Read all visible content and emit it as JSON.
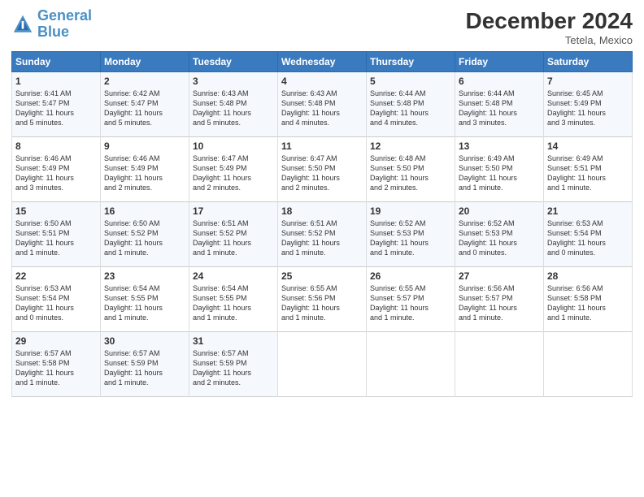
{
  "header": {
    "logo_line1": "General",
    "logo_line2": "Blue",
    "month": "December 2024",
    "location": "Tetela, Mexico"
  },
  "days_of_week": [
    "Sunday",
    "Monday",
    "Tuesday",
    "Wednesday",
    "Thursday",
    "Friday",
    "Saturday"
  ],
  "weeks": [
    [
      {
        "day": "1",
        "text": "Sunrise: 6:41 AM\nSunset: 5:47 PM\nDaylight: 11 hours\nand 5 minutes."
      },
      {
        "day": "2",
        "text": "Sunrise: 6:42 AM\nSunset: 5:47 PM\nDaylight: 11 hours\nand 5 minutes."
      },
      {
        "day": "3",
        "text": "Sunrise: 6:43 AM\nSunset: 5:48 PM\nDaylight: 11 hours\nand 5 minutes."
      },
      {
        "day": "4",
        "text": "Sunrise: 6:43 AM\nSunset: 5:48 PM\nDaylight: 11 hours\nand 4 minutes."
      },
      {
        "day": "5",
        "text": "Sunrise: 6:44 AM\nSunset: 5:48 PM\nDaylight: 11 hours\nand 4 minutes."
      },
      {
        "day": "6",
        "text": "Sunrise: 6:44 AM\nSunset: 5:48 PM\nDaylight: 11 hours\nand 3 minutes."
      },
      {
        "day": "7",
        "text": "Sunrise: 6:45 AM\nSunset: 5:49 PM\nDaylight: 11 hours\nand 3 minutes."
      }
    ],
    [
      {
        "day": "8",
        "text": "Sunrise: 6:46 AM\nSunset: 5:49 PM\nDaylight: 11 hours\nand 3 minutes."
      },
      {
        "day": "9",
        "text": "Sunrise: 6:46 AM\nSunset: 5:49 PM\nDaylight: 11 hours\nand 2 minutes."
      },
      {
        "day": "10",
        "text": "Sunrise: 6:47 AM\nSunset: 5:49 PM\nDaylight: 11 hours\nand 2 minutes."
      },
      {
        "day": "11",
        "text": "Sunrise: 6:47 AM\nSunset: 5:50 PM\nDaylight: 11 hours\nand 2 minutes."
      },
      {
        "day": "12",
        "text": "Sunrise: 6:48 AM\nSunset: 5:50 PM\nDaylight: 11 hours\nand 2 minutes."
      },
      {
        "day": "13",
        "text": "Sunrise: 6:49 AM\nSunset: 5:50 PM\nDaylight: 11 hours\nand 1 minute."
      },
      {
        "day": "14",
        "text": "Sunrise: 6:49 AM\nSunset: 5:51 PM\nDaylight: 11 hours\nand 1 minute."
      }
    ],
    [
      {
        "day": "15",
        "text": "Sunrise: 6:50 AM\nSunset: 5:51 PM\nDaylight: 11 hours\nand 1 minute."
      },
      {
        "day": "16",
        "text": "Sunrise: 6:50 AM\nSunset: 5:52 PM\nDaylight: 11 hours\nand 1 minute."
      },
      {
        "day": "17",
        "text": "Sunrise: 6:51 AM\nSunset: 5:52 PM\nDaylight: 11 hours\nand 1 minute."
      },
      {
        "day": "18",
        "text": "Sunrise: 6:51 AM\nSunset: 5:52 PM\nDaylight: 11 hours\nand 1 minute."
      },
      {
        "day": "19",
        "text": "Sunrise: 6:52 AM\nSunset: 5:53 PM\nDaylight: 11 hours\nand 1 minute."
      },
      {
        "day": "20",
        "text": "Sunrise: 6:52 AM\nSunset: 5:53 PM\nDaylight: 11 hours\nand 0 minutes."
      },
      {
        "day": "21",
        "text": "Sunrise: 6:53 AM\nSunset: 5:54 PM\nDaylight: 11 hours\nand 0 minutes."
      }
    ],
    [
      {
        "day": "22",
        "text": "Sunrise: 6:53 AM\nSunset: 5:54 PM\nDaylight: 11 hours\nand 0 minutes."
      },
      {
        "day": "23",
        "text": "Sunrise: 6:54 AM\nSunset: 5:55 PM\nDaylight: 11 hours\nand 1 minute."
      },
      {
        "day": "24",
        "text": "Sunrise: 6:54 AM\nSunset: 5:55 PM\nDaylight: 11 hours\nand 1 minute."
      },
      {
        "day": "25",
        "text": "Sunrise: 6:55 AM\nSunset: 5:56 PM\nDaylight: 11 hours\nand 1 minute."
      },
      {
        "day": "26",
        "text": "Sunrise: 6:55 AM\nSunset: 5:57 PM\nDaylight: 11 hours\nand 1 minute."
      },
      {
        "day": "27",
        "text": "Sunrise: 6:56 AM\nSunset: 5:57 PM\nDaylight: 11 hours\nand 1 minute."
      },
      {
        "day": "28",
        "text": "Sunrise: 6:56 AM\nSunset: 5:58 PM\nDaylight: 11 hours\nand 1 minute."
      }
    ],
    [
      {
        "day": "29",
        "text": "Sunrise: 6:57 AM\nSunset: 5:58 PM\nDaylight: 11 hours\nand 1 minute."
      },
      {
        "day": "30",
        "text": "Sunrise: 6:57 AM\nSunset: 5:59 PM\nDaylight: 11 hours\nand 1 minute."
      },
      {
        "day": "31",
        "text": "Sunrise: 6:57 AM\nSunset: 5:59 PM\nDaylight: 11 hours\nand 2 minutes."
      },
      null,
      null,
      null,
      null
    ]
  ]
}
